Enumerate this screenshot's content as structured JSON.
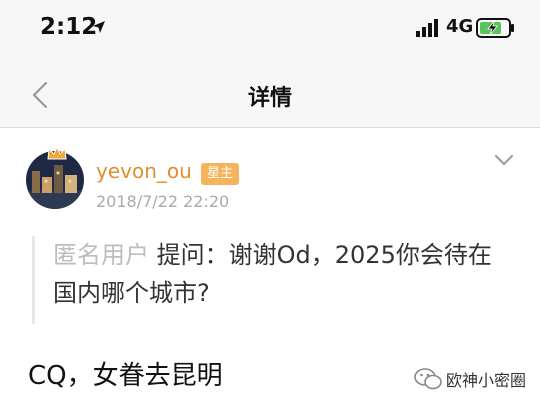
{
  "status_bar": {
    "time": "2:12",
    "network": "4G"
  },
  "nav": {
    "title": "详情"
  },
  "post": {
    "username": "yevon_ou",
    "badge": "星主",
    "timestamp": "2018/7/22 22:20",
    "question_author": "匿名用户",
    "question_text": "提问：谢谢Od，2025你会待在国内哪个城市?",
    "answer": "CQ，女眷去昆明"
  },
  "watermark": {
    "text": "欧神小密圈"
  },
  "icons": [
    "location-arrow-icon",
    "signal-icon",
    "battery-icon",
    "back-chevron-icon",
    "chevron-down-icon",
    "crown-icon",
    "wechat-icon"
  ],
  "colors": {
    "username": "#e08f2b",
    "badge": "#f7b35b",
    "battery_fill": "#5ac35a"
  }
}
